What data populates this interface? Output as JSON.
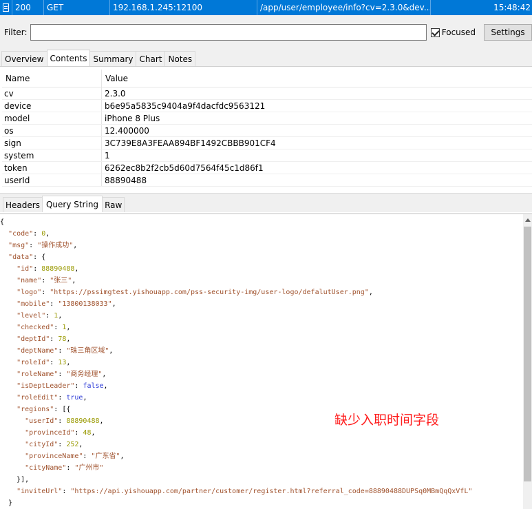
{
  "request": {
    "status": "200",
    "method": "GET",
    "host": "192.168.1.245:12100",
    "path": "/app/user/employee/info?cv=2.3.0&dev...",
    "time": "15:48:42"
  },
  "filter": {
    "label": "Filter:",
    "value": "",
    "placeholder": "",
    "focused_label": "Focused",
    "focused_checked": true,
    "settings_label": "Settings"
  },
  "tabs": [
    "Overview",
    "Contents",
    "Summary",
    "Chart",
    "Notes"
  ],
  "grid": {
    "headers": {
      "name": "Name",
      "value": "Value"
    },
    "rows": [
      {
        "name": "cv",
        "value": "2.3.0"
      },
      {
        "name": "device",
        "value": "b6e95a5835c9404a9f4dacfdc9563121"
      },
      {
        "name": "model",
        "value": "iPhone 8 Plus"
      },
      {
        "name": "os",
        "value": "12.400000"
      },
      {
        "name": "sign",
        "value": "3C739E8A3FEAA894BF1492CBBB901CF4"
      },
      {
        "name": "system",
        "value": "1"
      },
      {
        "name": "token",
        "value": "6262ec8b2f2cb5d60d7564f45c1d86f1"
      },
      {
        "name": "userId",
        "value": "88890488"
      }
    ]
  },
  "subtabs": [
    "Headers",
    "Query String",
    "Raw"
  ],
  "json_lines": [
    [
      [
        "p",
        "{"
      ]
    ],
    [
      [
        "p",
        "  "
      ],
      [
        "k",
        "\"code\""
      ],
      [
        "p",
        ": "
      ],
      [
        "n",
        "0"
      ],
      [
        "p",
        ","
      ]
    ],
    [
      [
        "p",
        "  "
      ],
      [
        "k",
        "\"msg\""
      ],
      [
        "p",
        ": "
      ],
      [
        "s",
        "\"操作成功\""
      ],
      [
        "p",
        ","
      ]
    ],
    [
      [
        "p",
        "  "
      ],
      [
        "k",
        "\"data\""
      ],
      [
        "p",
        ": {"
      ]
    ],
    [
      [
        "p",
        "    "
      ],
      [
        "k",
        "\"id\""
      ],
      [
        "p",
        ": "
      ],
      [
        "n",
        "88890488"
      ],
      [
        "p",
        ","
      ]
    ],
    [
      [
        "p",
        "    "
      ],
      [
        "k",
        "\"name\""
      ],
      [
        "p",
        ": "
      ],
      [
        "s",
        "\"张三\""
      ],
      [
        "p",
        ","
      ]
    ],
    [
      [
        "p",
        "    "
      ],
      [
        "k",
        "\"logo\""
      ],
      [
        "p",
        ": "
      ],
      [
        "s",
        "\"https://pssimgtest.yishouapp.com/pss-security-img/user-logo/defalutUser.png\""
      ],
      [
        "p",
        ","
      ]
    ],
    [
      [
        "p",
        "    "
      ],
      [
        "k",
        "\"mobile\""
      ],
      [
        "p",
        ": "
      ],
      [
        "s",
        "\"13800138033\""
      ],
      [
        "p",
        ","
      ]
    ],
    [
      [
        "p",
        "    "
      ],
      [
        "k",
        "\"level\""
      ],
      [
        "p",
        ": "
      ],
      [
        "n",
        "1"
      ],
      [
        "p",
        ","
      ]
    ],
    [
      [
        "p",
        "    "
      ],
      [
        "k",
        "\"checked\""
      ],
      [
        "p",
        ": "
      ],
      [
        "n",
        "1"
      ],
      [
        "p",
        ","
      ]
    ],
    [
      [
        "p",
        "    "
      ],
      [
        "k",
        "\"deptId\""
      ],
      [
        "p",
        ": "
      ],
      [
        "n",
        "78"
      ],
      [
        "p",
        ","
      ]
    ],
    [
      [
        "p",
        "    "
      ],
      [
        "k",
        "\"deptName\""
      ],
      [
        "p",
        ": "
      ],
      [
        "s",
        "\"珠三角区域\""
      ],
      [
        "p",
        ","
      ]
    ],
    [
      [
        "p",
        "    "
      ],
      [
        "k",
        "\"roleId\""
      ],
      [
        "p",
        ": "
      ],
      [
        "n",
        "13"
      ],
      [
        "p",
        ","
      ]
    ],
    [
      [
        "p",
        "    "
      ],
      [
        "k",
        "\"roleName\""
      ],
      [
        "p",
        ": "
      ],
      [
        "s",
        "\"商务经理\""
      ],
      [
        "p",
        ","
      ]
    ],
    [
      [
        "p",
        "    "
      ],
      [
        "k",
        "\"isDeptLeader\""
      ],
      [
        "p",
        ": "
      ],
      [
        "b",
        "false"
      ],
      [
        "p",
        ","
      ]
    ],
    [
      [
        "p",
        "    "
      ],
      [
        "k",
        "\"roleEdit\""
      ],
      [
        "p",
        ": "
      ],
      [
        "b",
        "true"
      ],
      [
        "p",
        ","
      ]
    ],
    [
      [
        "p",
        "    "
      ],
      [
        "k",
        "\"regions\""
      ],
      [
        "p",
        ": [{"
      ]
    ],
    [
      [
        "p",
        "      "
      ],
      [
        "k",
        "\"userId\""
      ],
      [
        "p",
        ": "
      ],
      [
        "n",
        "88890488"
      ],
      [
        "p",
        ","
      ]
    ],
    [
      [
        "p",
        "      "
      ],
      [
        "k",
        "\"provinceId\""
      ],
      [
        "p",
        ": "
      ],
      [
        "n",
        "48"
      ],
      [
        "p",
        ","
      ]
    ],
    [
      [
        "p",
        "      "
      ],
      [
        "k",
        "\"cityId\""
      ],
      [
        "p",
        ": "
      ],
      [
        "n",
        "252"
      ],
      [
        "p",
        ","
      ]
    ],
    [
      [
        "p",
        "      "
      ],
      [
        "k",
        "\"provinceName\""
      ],
      [
        "p",
        ": "
      ],
      [
        "s",
        "\"广东省\""
      ],
      [
        "p",
        ","
      ]
    ],
    [
      [
        "p",
        "      "
      ],
      [
        "k",
        "\"cityName\""
      ],
      [
        "p",
        ": "
      ],
      [
        "s",
        "\"广州市\""
      ]
    ],
    [
      [
        "p",
        "    }],"
      ]
    ],
    [
      [
        "p",
        "    "
      ],
      [
        "k",
        "\"inviteUrl\""
      ],
      [
        "p",
        ": "
      ],
      [
        "s",
        "\"https://api.yishouapp.com/partner/customer/register.html?referral_code=88890488DUPSq0MBmQqQxVfL\""
      ]
    ],
    [
      [
        "p",
        "  }"
      ]
    ]
  ],
  "annotation": "缺少入职时间字段",
  "colors": {
    "selection": "#0078d7",
    "annotation": "#ff1d1d",
    "json_key": "#a0522d",
    "json_number": "#999900",
    "json_bool": "#2a38d6"
  }
}
